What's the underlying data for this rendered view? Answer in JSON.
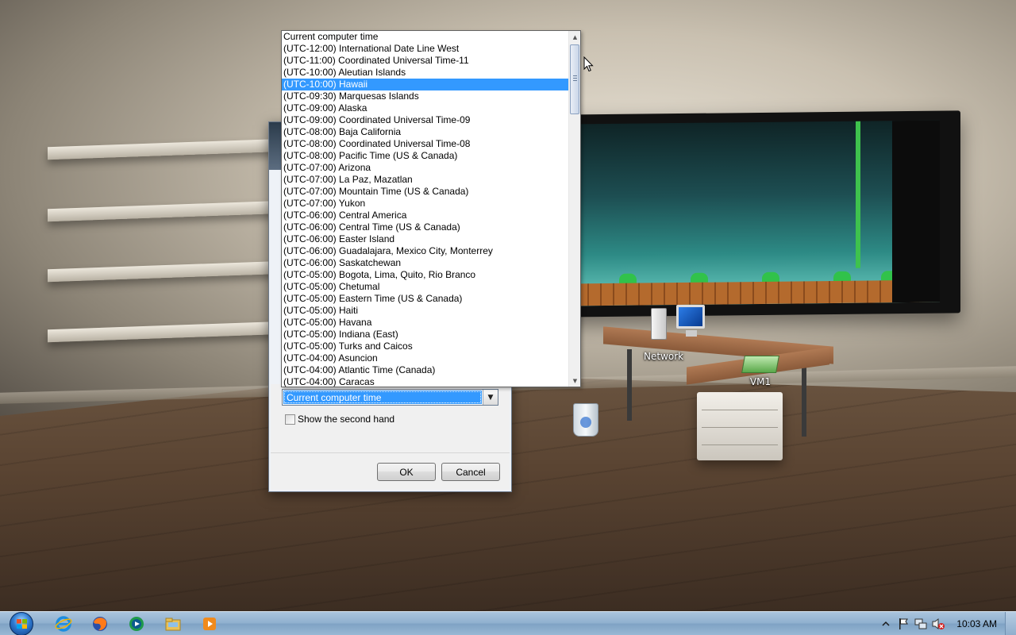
{
  "desktop": {
    "icons": {
      "network_label": "Network",
      "vm_label": "VM1"
    }
  },
  "dialog": {
    "selected_time_zone": "Current computer time",
    "show_second_hand_label": "Show the second hand",
    "show_second_hand_checked": false,
    "ok_label": "OK",
    "cancel_label": "Cancel"
  },
  "dropdown": {
    "selected_index": 4,
    "items": [
      "Current computer time",
      "(UTC-12:00) International Date Line West",
      "(UTC-11:00) Coordinated Universal Time-11",
      "(UTC-10:00) Aleutian Islands",
      "(UTC-10:00) Hawaii",
      "(UTC-09:30) Marquesas Islands",
      "(UTC-09:00) Alaska",
      "(UTC-09:00) Coordinated Universal Time-09",
      "(UTC-08:00) Baja California",
      "(UTC-08:00) Coordinated Universal Time-08",
      "(UTC-08:00) Pacific Time (US & Canada)",
      "(UTC-07:00) Arizona",
      "(UTC-07:00) La Paz, Mazatlan",
      "(UTC-07:00) Mountain Time (US & Canada)",
      "(UTC-07:00) Yukon",
      "(UTC-06:00) Central America",
      "(UTC-06:00) Central Time (US & Canada)",
      "(UTC-06:00) Easter Island",
      "(UTC-06:00) Guadalajara, Mexico City, Monterrey",
      "(UTC-06:00) Saskatchewan",
      "(UTC-05:00) Bogota, Lima, Quito, Rio Branco",
      "(UTC-05:00) Chetumal",
      "(UTC-05:00) Eastern Time (US & Canada)",
      "(UTC-05:00) Haiti",
      "(UTC-05:00) Havana",
      "(UTC-05:00) Indiana (East)",
      "(UTC-05:00) Turks and Caicos",
      "(UTC-04:00) Asuncion",
      "(UTC-04:00) Atlantic Time (Canada)",
      "(UTC-04:00) Caracas"
    ]
  },
  "taskbar": {
    "pinned": [
      "internet-explorer-icon",
      "firefox-icon",
      "media-center-icon",
      "file-explorer-icon",
      "media-player-icon"
    ],
    "tray_icons": [
      "show-hidden-icons-arrow",
      "action-center-flag-icon",
      "network-icon",
      "volume-muted-icon"
    ],
    "clock": "10:03 AM"
  },
  "colors": {
    "selection": "#3399ff",
    "taskbar": "#8fb0cf"
  }
}
